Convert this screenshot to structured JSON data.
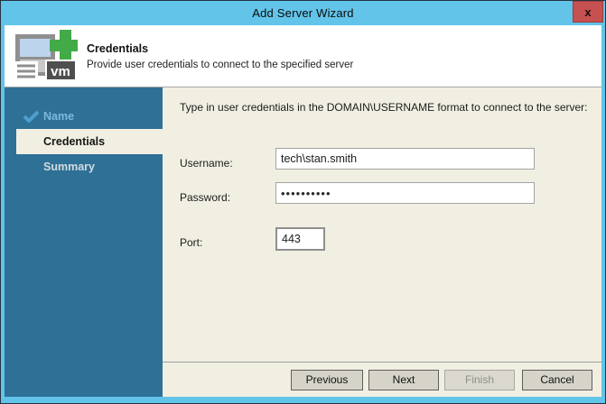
{
  "window": {
    "title": "Add Server Wizard",
    "close_label": "x"
  },
  "header": {
    "title": "Credentials",
    "subtitle": "Provide user credentials to connect to the specified server",
    "icon": "add-vm-server-icon"
  },
  "sidebar": {
    "items": [
      {
        "label": "Name",
        "state": "completed",
        "icon": "checkmark-icon"
      },
      {
        "label": "Credentials",
        "state": "active"
      },
      {
        "label": "Summary",
        "state": "upcoming"
      }
    ]
  },
  "content": {
    "instruction": "Type in user credentials in the DOMAIN\\USERNAME format to connect to the server:",
    "fields": {
      "username": {
        "label": "Username:",
        "value": "tech\\stan.smith"
      },
      "password": {
        "label": "Password:",
        "value": "••••••••••"
      },
      "port": {
        "label": "Port:",
        "value": "443"
      }
    }
  },
  "footer": {
    "buttons": [
      {
        "label": "Previous",
        "enabled": true
      },
      {
        "label": "Next",
        "enabled": true
      },
      {
        "label": "Finish",
        "enabled": false
      },
      {
        "label": "Cancel",
        "enabled": true
      }
    ]
  },
  "colors": {
    "titlebar_blue": "#62c4e8",
    "sidebar_teal": "#2e7096",
    "content_cream": "#f1efe2",
    "close_red": "#c75050",
    "completed_step_blue": "#7db9de",
    "plus_green": "#42ab47"
  }
}
